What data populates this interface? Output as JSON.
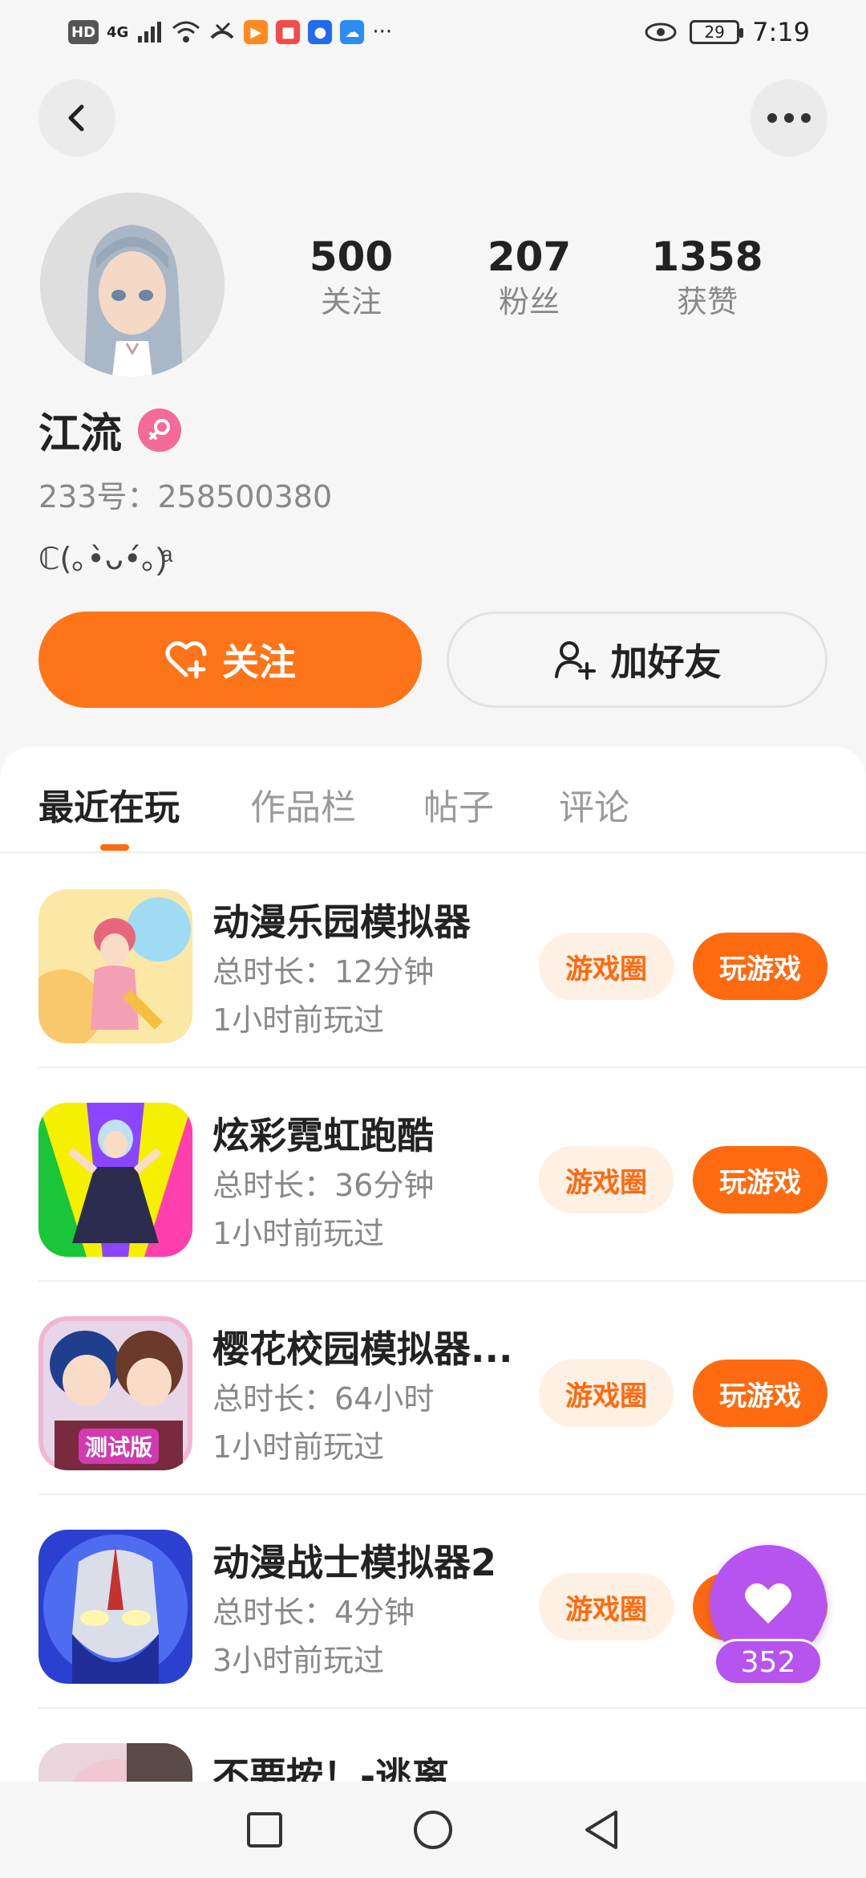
{
  "status_bar": {
    "left_badges": [
      "HD",
      "4G"
    ],
    "battery": "29",
    "time": "7:19"
  },
  "profile": {
    "name": "江流",
    "uid_text": "233号：258500380",
    "bio": "ℂ(｡•̀ᴗ•́｡)ͣ",
    "stats": [
      {
        "value": "500",
        "label": "关注"
      },
      {
        "value": "207",
        "label": "粉丝"
      },
      {
        "value": "1358",
        "label": "获赞"
      }
    ],
    "follow_label": "关注",
    "add_friend_label": "加好友"
  },
  "tabs": [
    "最近在玩",
    "作品栏",
    "帖子",
    "评论"
  ],
  "games": [
    {
      "title": "动漫乐园模拟器",
      "duration": "总时长：12分钟",
      "last_played": "1小时前玩过",
      "circle_label": "游戏圈",
      "play_label": "玩游戏"
    },
    {
      "title": "炫彩霓虹跑酷",
      "duration": "总时长：36分钟",
      "last_played": "1小时前玩过",
      "circle_label": "游戏圈",
      "play_label": "玩游戏"
    },
    {
      "title": "樱花校园模拟器...",
      "duration": "总时长：64小时",
      "last_played": "1小时前玩过",
      "circle_label": "游戏圈",
      "play_label": "玩游戏",
      "icon_badge": "测试版"
    },
    {
      "title": "动漫战士模拟器2",
      "duration": "总时长：4分钟",
      "last_played": "3小时前玩过",
      "circle_label": "游戏圈",
      "play_label": "玩游戏"
    },
    {
      "title": "不要按！-逃离",
      "duration": "",
      "last_played": "",
      "circle_label": "",
      "play_label": ""
    }
  ],
  "like_fab": {
    "count": "352"
  },
  "colors": {
    "accent": "#fe6a10",
    "fab": "#b754f0",
    "gender": "#f46b9a"
  }
}
